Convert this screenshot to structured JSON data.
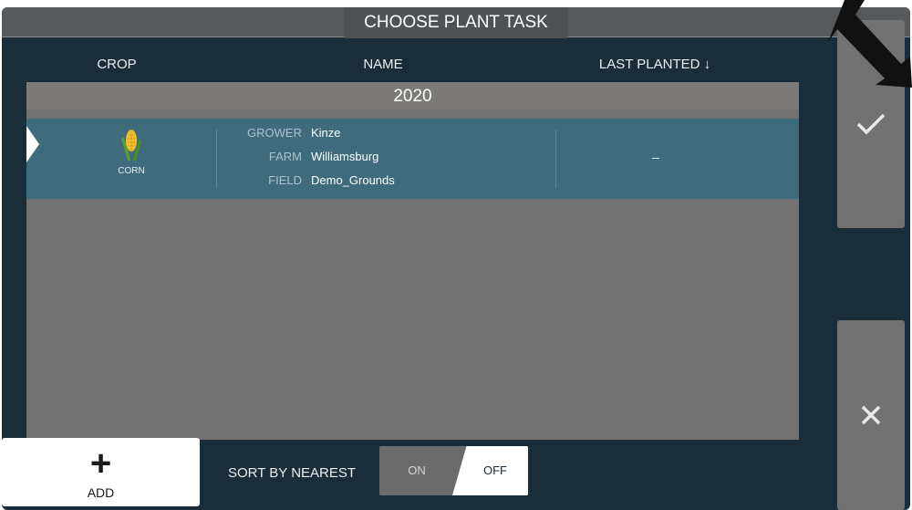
{
  "dialog": {
    "title": "CHOOSE PLANT TASK"
  },
  "columns": {
    "crop": "CROP",
    "name": "NAME",
    "last_planted": "LAST PLANTED ↓"
  },
  "group": {
    "year": "2020"
  },
  "rows": [
    {
      "crop": "CORN",
      "crop_icon": "corn-icon",
      "grower_key": "GROWER",
      "grower": "Kinze",
      "farm_key": "FARM",
      "farm": "Williamsburg",
      "field_key": "FIELD",
      "field": "Demo_Grounds",
      "last_planted": "–",
      "selected": true
    }
  ],
  "actions": {
    "confirm_icon": "checkmark-icon",
    "cancel_icon": "close-icon",
    "add_label": "ADD",
    "add_icon": "plus-icon"
  },
  "sort": {
    "label": "SORT BY NEAREST",
    "on": "ON",
    "off": "OFF",
    "value": "OFF"
  },
  "colors": {
    "background": "#1a2d3a",
    "panel": "#727272",
    "selected_row": "#3f6c7c",
    "white": "#ffffff"
  }
}
